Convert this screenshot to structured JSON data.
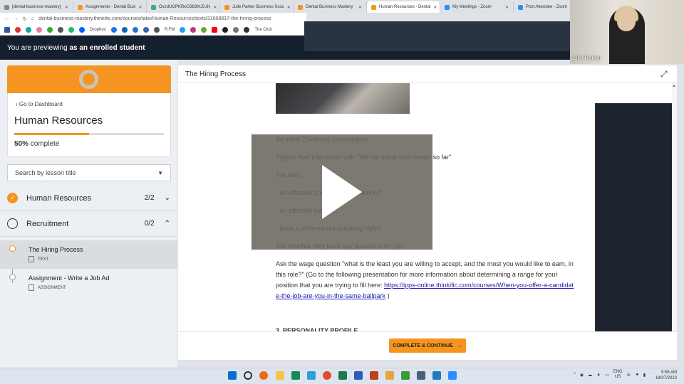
{
  "browser": {
    "tabs": [
      {
        "label": "[dental-business-mastery]"
      },
      {
        "label": "Assignments - Dental Busi"
      },
      {
        "label": "OvzdUGPKReO383hU5.6v"
      },
      {
        "label": "Julie Parker Business Succ"
      },
      {
        "label": "Dental Business Mastery"
      },
      {
        "label": "Human Resources - Dental"
      },
      {
        "label": "My Meetings - Zoom"
      },
      {
        "label": "Post Attendee - Zoom"
      }
    ],
    "url": "dental-business-mastery.thinkific.com/courses/take/Human-Resources/texts/31608817-the-hiring-process",
    "bookmarks": [
      "Dropbox",
      "R.FM",
      "The Club"
    ]
  },
  "preview": {
    "prefix": "You are previewing ",
    "role": "as an enrolled student"
  },
  "webcam": {
    "name": "Julie Parker"
  },
  "course": {
    "go_dashboard": "Go to Dashboard",
    "title": "Human Resources",
    "progress_percent": 50,
    "progress_value": "50%",
    "progress_suffix": " complete"
  },
  "search": {
    "placeholder": "Search by lesson title"
  },
  "chapters": [
    {
      "title": "Human Resources",
      "count": "2/2",
      "complete": true
    },
    {
      "title": "Recruitment",
      "count": "0/2",
      "complete": false
    }
  ],
  "lessons": [
    {
      "title": "The Hiring Process",
      "type": "TEXT",
      "active": true
    },
    {
      "title": "Assignment - Write a Job Ad",
      "type": "ASSIGNMENT",
      "active": false
    }
  ],
  "lesson_header": {
    "title": "The Hiring Process"
  },
  "content": {
    "p1": "An initial 20-minute conversation",
    "p2": "Trigger their interaction with \"Tell me about your career so far\"",
    "p3": "Are they...",
    "p4": "- an effective communicator, friendly?",
    "p5": "- an effective listener?",
    "p6": "- have a professional speaking style?",
    "p7": "Ask whether they have any questions for you.",
    "p8": "Ask the wage question \"what is the least you are willing to accept, and the most you would like to earn, in this role?\" (Go to the following presentation for more information about determining a range for your position that you are trying to fill here: ",
    "link": "https://ipps-online.thinkific.com/courses/When-you-offer-a-candidate-the-job-are-you-in-the-same-ballpark",
    "p8_end": " )",
    "heading3": "3. PERSONALITY PROFILE"
  },
  "footer": {
    "complete_button": "COMPLETE & CONTINUE",
    "arrow": "→"
  },
  "taskbar": {
    "lang_top": "ENG",
    "lang_bottom": "US",
    "time": "9:56 AM",
    "date": "18/07/2022"
  },
  "colors": {
    "accent": "#f5941f",
    "dark": "#15202e"
  }
}
